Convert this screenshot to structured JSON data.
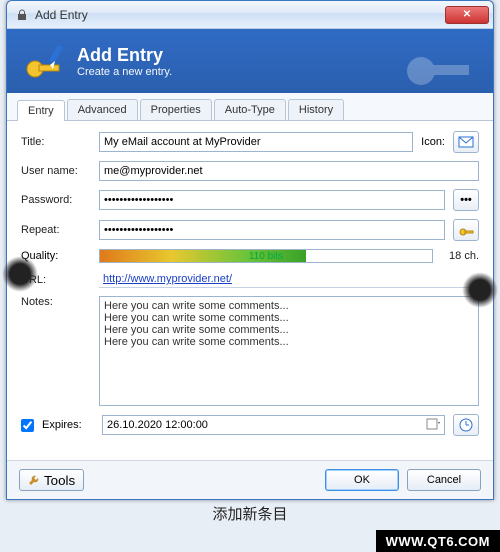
{
  "window": {
    "title": "Add Entry"
  },
  "banner": {
    "heading": "Add Entry",
    "sub": "Create a new entry."
  },
  "tabs": [
    {
      "label": "Entry",
      "active": true
    },
    {
      "label": "Advanced"
    },
    {
      "label": "Properties"
    },
    {
      "label": "Auto-Type"
    },
    {
      "label": "History"
    }
  ],
  "form": {
    "title_label": "Title:",
    "title_value": "My eMail account at MyProvider",
    "icon_label": "Icon:",
    "user_label": "User name:",
    "user_value": "me@myprovider.net",
    "pw_label": "Password:",
    "pw_value": "••••••••••••••••••",
    "repeat_label": "Repeat:",
    "repeat_value": "••••••••••••••••••",
    "quality_label": "Quality:",
    "quality_text": "110 bits",
    "quality_ch": "18 ch.",
    "url_label": "URL:",
    "url_value": "http://www.myprovider.net/",
    "notes_label": "Notes:",
    "notes_value": "Here you can write some comments...\nHere you can write some comments...\nHere you can write some comments...\nHere you can write some comments...",
    "expires_label": "Expires:",
    "expires_value": "26.10.2020 12:00:00"
  },
  "footer": {
    "tools": "Tools",
    "ok": "OK",
    "cancel": "Cancel"
  },
  "caption": "添加新条目",
  "watermark": "WWW.QT6.COM"
}
